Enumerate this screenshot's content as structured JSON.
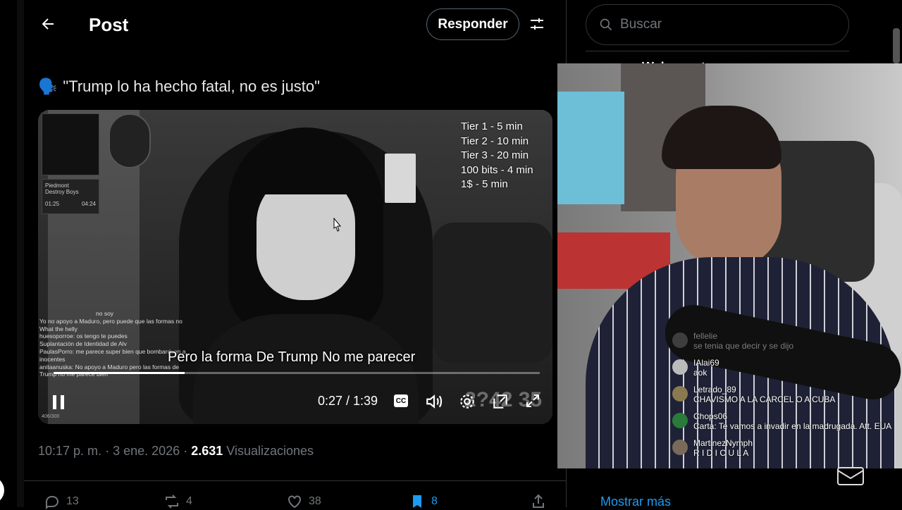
{
  "header": {
    "title": "Post",
    "reply_label": "Responder"
  },
  "post": {
    "emoji": "🗣️",
    "text": "\"Trump lo ha hecho fatal, no es justo\"",
    "meta": {
      "time": "10:17 p. m.",
      "dot": "·",
      "date": "3 ene. 2026",
      "dot2": "·",
      "views": "2.631",
      "views_label": "Visualizaciones"
    }
  },
  "video": {
    "tiers": [
      "Tier 1 - 5 min",
      "Tier 2 - 10 min",
      "Tier 3 - 20 min",
      "100 bits - 4 min",
      "1$ - 5 min"
    ],
    "caption": "Pero la forma De Trump No me parecer",
    "time": "0:27 / 1:39",
    "cc_label": "CC",
    "ghost_text": "2?42 35",
    "progress": 0.27,
    "now_playing": {
      "title": "Piedmont",
      "artist": "Destroy Boys",
      "elapsed": "01:25",
      "total": "04:24"
    },
    "chat_lines": [
      "no soy",
      "Yo no apoyo a Maduro, pero puede que las formas no",
      "What the helly",
      "huesoporroe: os tengo te puedes",
      "Suplantación de Identidad de Alv",
      "PaulasPorro: me parece super bien que bombardeen a inocentes",
      "anitaanuska: No apoyo a Maduro pero las formas de Trump no me parece bien"
    ],
    "viewer_count": "406/300"
  },
  "actions": {
    "replies": "13",
    "reposts": "4",
    "likes": "38",
    "bookmarks": "8"
  },
  "sidebar": {
    "search_placeholder": "Buscar",
    "show_more": "Mostrar más",
    "trend_snippet": "Welcome to..."
  },
  "stream_chat": [
    {
      "user": "fellelie",
      "text": "se tenia que decir y se dijo",
      "faded": true,
      "color": "#777"
    },
    {
      "user": "IAlai69",
      "text": "aok",
      "faded": false,
      "color": "#bbb"
    },
    {
      "user": "Letrado_89",
      "text": "CHAVISMO A LA CARCEL O A CUBA",
      "faded": false,
      "color": "#8a7a50"
    },
    {
      "user": "Chops06",
      "text": "Carta: Te vamos a invadir en la madrugada. Att. EUA",
      "faded": false,
      "color": "#2a7a3a"
    },
    {
      "user": "MartinezNymph",
      "text": "R I D I C U L A",
      "faded": false,
      "color": "#7a6a5a"
    }
  ],
  "colors": {
    "accent": "#1d9bf0",
    "bookmark": "#1d9bf0"
  }
}
